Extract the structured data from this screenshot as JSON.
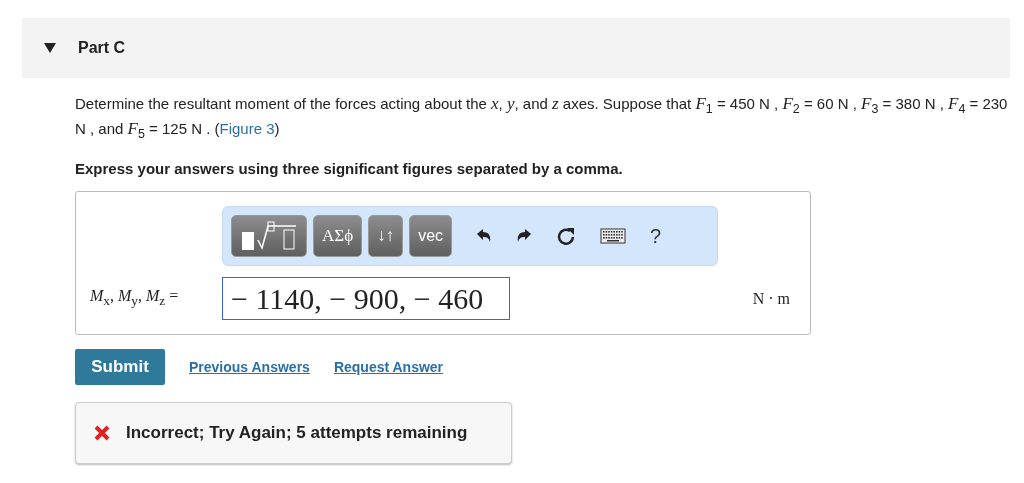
{
  "part": {
    "title": "Part C",
    "expanded": true
  },
  "problem": {
    "text": "Determine the resultant moment of the forces acting about the *x*, *y*, and *z* axes. Suppose that *F*$_{1}$ = 450  N , *F*$_{2}$ = 60  N , *F*$_{3}$ = 380  N , *F*$_{4}$ = 230  N , and *F*$_{5}$ = 125  N . (",
    "link": "Figure 3",
    "text_after": ")"
  },
  "instruction": "Express your answers using three significant figures separated by a comma.",
  "toolbar": {
    "buttons": [
      {
        "kind": "templates"
      },
      {
        "kind": "text",
        "label": "ΑΣϕ"
      },
      {
        "kind": "text",
        "label": "↓↑"
      },
      {
        "kind": "text",
        "label": "vec"
      }
    ],
    "actions": [
      {
        "kind": "undo"
      },
      {
        "kind": "redo"
      },
      {
        "kind": "reset"
      },
      {
        "kind": "keyboard"
      },
      {
        "kind": "text",
        "label": "?"
      }
    ]
  },
  "answer": {
    "label": "*M*$_{x}$, *M*$_{y}$, *M*$_{z}$ =",
    "value": "− 1140, − 900, − 460",
    "units": "N · m"
  },
  "actions": {
    "submit": "Submit",
    "links": [
      "Previous Answers",
      "Request Answer"
    ]
  },
  "feedback": {
    "text": "Incorrect; Try Again; 5 attempts remaining"
  }
}
